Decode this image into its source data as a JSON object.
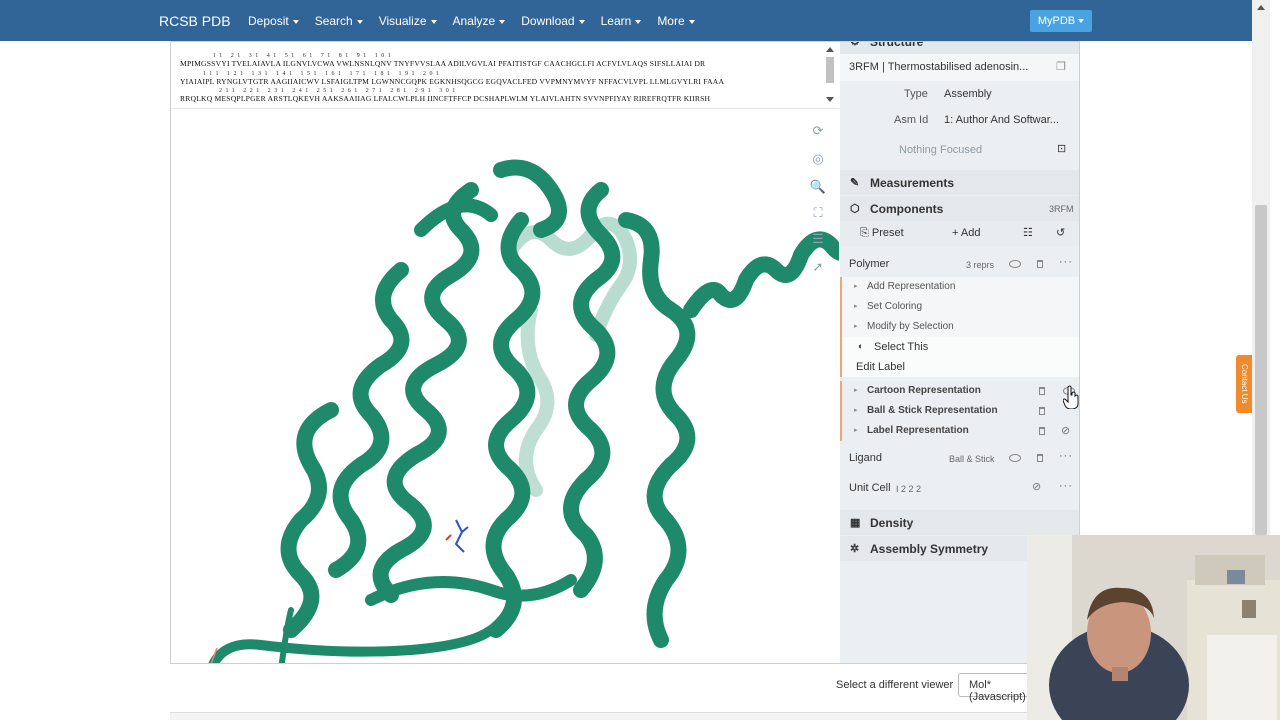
{
  "nav": {
    "brand": "RCSB PDB",
    "items": [
      "Deposit",
      "Search",
      "Visualize",
      "Analyze",
      "Download",
      "Learn",
      "More"
    ],
    "mypdb": "MyPDB"
  },
  "sequence": {
    "row1_nums": "11 21 31 41 51 61 71 81 91 101",
    "row1": "MPIMGSSVYI TVELAIAVLA ILGNVLVCWA VWLNSNLQNV TNYFVVSLAA ADILVGVLAI PFAITISTGF CAACHGCLFI ACFVLVLAQS SIFSLLAIAI DR",
    "row2_nums": "111 121 131 141 151 161 171 181 191 201",
    "row2": "YIAIAIPL RYNGLVTGTR AAGIIAICWV LSFAIGLTPM LGWNNCGQPK EGKNHSQGCG EGQVACLFED VVPMNYMVYF NFFACVLVPL LLMLGVYLRI FAAA",
    "row3_nums": "211 221 231 241 251 261 271 281 291 301",
    "row3": "RRQLKQ MESQPLPGER ARSTLQKEVH AAKSAAIIAG LFALCWLPLH IINCFTFFCP DCSHAPLWLM YLAIVLAHTN SVVNPFIYAY RIREFRQTFR KIIRSH"
  },
  "panel": {
    "structure_header": "Structure",
    "entry_label": "3RFM | Thermostabilised adenosin...",
    "type_key": "Type",
    "type_value": "Assembly",
    "asm_key": "Asm Id",
    "asm_value": "1: Author And Softwar...",
    "focus": "Nothing Focused",
    "measurements": "Measurements",
    "components": "Components",
    "components_id": "3RFM",
    "preset": "Preset",
    "add": "Add",
    "polymer": "Polymer",
    "polymer_reprs": "3 reprs",
    "menu": [
      "Add Representation",
      "Set Coloring",
      "Modify by Selection"
    ],
    "select_this": "Select This",
    "edit_label": "Edit Label",
    "representations": [
      "Cartoon Representation",
      "Ball & Stick Representation",
      "Label Representation"
    ],
    "ligand": "Ligand",
    "ligand_repr": "Ball & Stick",
    "unit_cell": "Unit Cell",
    "unit_cell_group": "I 2 2 2",
    "density": "Density",
    "assembly_symmetry": "Assembly Symmetry"
  },
  "bottom": {
    "select_viewer": "Select a different viewer",
    "viewer_value": "Mol* (Javascript)"
  },
  "contact": "Contact Us",
  "colors": {
    "nav": "#326597",
    "protein": "#1f8a6a",
    "panel_bg": "#eceff1",
    "accent": "#f1a478"
  }
}
